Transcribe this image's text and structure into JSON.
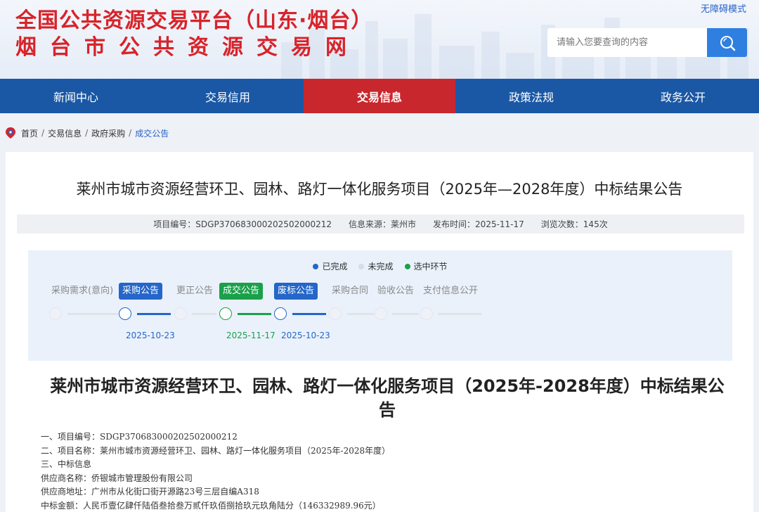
{
  "header": {
    "title_line1": "全国公共资源交易平台（山东·烟台）",
    "title_line2": "烟台市公共资源交易网",
    "accessible_mode": "无障碍模式",
    "search_placeholder": "请输入您要查询的内容"
  },
  "nav": {
    "items": [
      {
        "label": "新闻中心"
      },
      {
        "label": "交易信用"
      },
      {
        "label": "交易信息",
        "active": true
      },
      {
        "label": "政策法规"
      },
      {
        "label": "政务公开"
      }
    ]
  },
  "breadcrumb": {
    "items": [
      "首页",
      "交易信息",
      "政府采购",
      "成交公告"
    ],
    "separator": "/"
  },
  "article": {
    "title": "莱州市城市资源经营环卫、园林、路灯一体化服务项目（2025年—2028年度）中标结果公告",
    "meta": {
      "project_no": "项目编号：SDGP370683000202502000212",
      "source": "信息来源：莱州市",
      "publish_time": "发布时间：2025-11-17",
      "views": "浏览次数：145次"
    }
  },
  "progress": {
    "legend": {
      "done": "已完成",
      "todo": "未完成",
      "selected": "选中环节"
    },
    "colors": {
      "done": "#2466c9",
      "todo": "#e1e3e7",
      "selected": "#1aa04a"
    },
    "steps": [
      {
        "label": "采购需求(意向)",
        "state": "todo",
        "date": ""
      },
      {
        "label": "采购公告",
        "state": "done",
        "date": "2025-10-23"
      },
      {
        "label": "更正公告",
        "state": "todo",
        "date": ""
      },
      {
        "label": "成交公告",
        "state": "selected",
        "date": "2025-11-17"
      },
      {
        "label": "废标公告",
        "state": "done",
        "date": "2025-10-23"
      },
      {
        "label": "采购合同",
        "state": "todo",
        "date": ""
      },
      {
        "label": "验收公告",
        "state": "todo",
        "date": ""
      },
      {
        "label": "支付信息公开",
        "state": "todo",
        "date": ""
      }
    ]
  },
  "document": {
    "title": "莱州市城市资源经营环卫、园林、路灯一体化服务项目（2025年-2028年度）中标结果公告",
    "lines": [
      "一、项目编号：SDGP370683000202502000212",
      "二、项目名称：莱州市城市资源经营环卫、园林、路灯一体化服务项目（2025年-2028年度）",
      "三、中标信息",
      "供应商名称：侨银城市管理股份有限公司",
      "供应商地址：广州市从化街口街开源路23号三层自编A318",
      "中标金额：人民币壹亿肆仟陆佰叁拾叁万贰仟玖佰捌拾玖元玖角陆分（146332989.96元）"
    ]
  }
}
